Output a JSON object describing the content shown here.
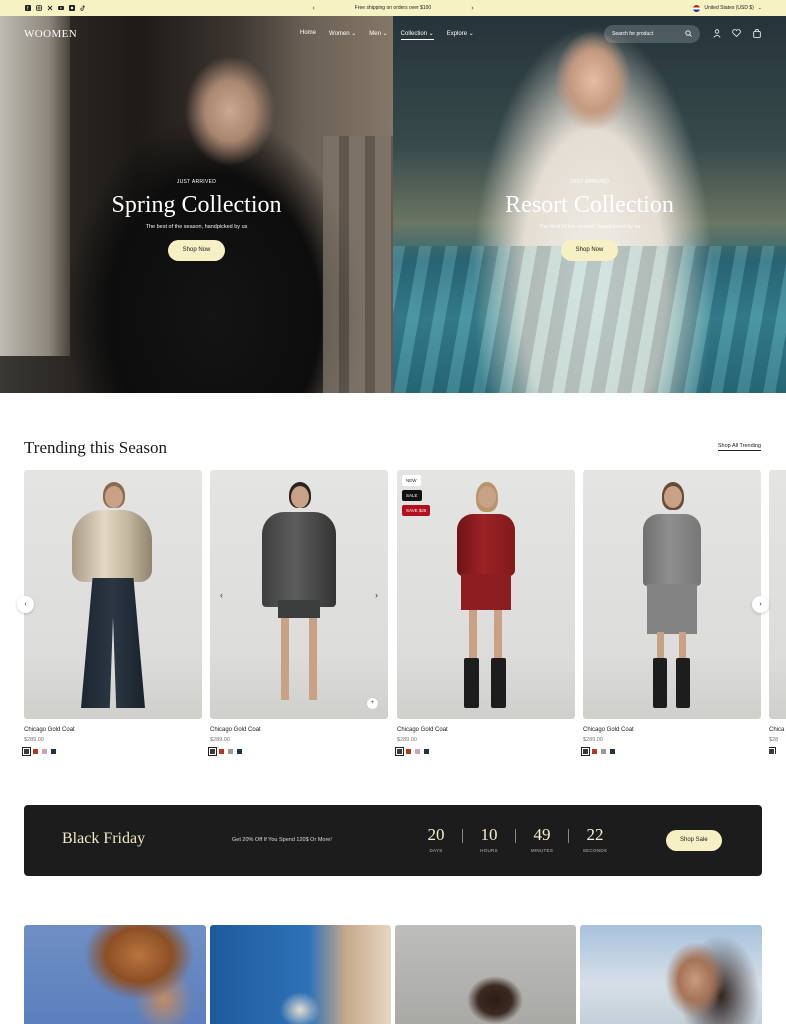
{
  "topbar": {
    "social_icons": [
      "facebook-icon",
      "instagram-icon",
      "x-icon",
      "youtube-icon",
      "pinterest-icon",
      "tiktok-icon"
    ],
    "announcement": "Free shipping on orders over $100",
    "prev_arrow": "‹",
    "next_arrow": "›",
    "country": "United States (USD $)",
    "country_chevron": "⌄"
  },
  "header": {
    "logo": "WOOMEN",
    "nav": [
      "Home",
      "Women ⌄",
      "Men ⌄",
      "Collection ⌄",
      "Explore ⌄"
    ],
    "active_nav": "Collection",
    "search_placeholder": "Search for product",
    "icons": [
      "search-icon",
      "account-icon",
      "wishlist-icon",
      "cart-icon"
    ]
  },
  "hero": {
    "left": {
      "kicker": "JUST ARRIVED",
      "title": "Spring Collection",
      "subtitle": "The best of the season, handpicked by us",
      "button": "Shop Now"
    },
    "right": {
      "kicker": "JUST ARRIVED",
      "title": "Resort Collection",
      "subtitle": "The best of the season, handpicked by us",
      "button": "Shop Now"
    }
  },
  "trending": {
    "title": "Trending this Season",
    "link": "Shop All Trending",
    "products": [
      {
        "name": "Chicago Gold Coat",
        "price": "$289.00",
        "swatches": [
          "#3a3a3a",
          "#b13a1a",
          "#c8a8b8",
          "#1c3550"
        ],
        "badges": []
      },
      {
        "name": "Chicago Gold Coat",
        "price": "$289.00",
        "swatches": [
          "#3a3a3a",
          "#b13a1a",
          "#9a9a9a",
          "#1c3550"
        ],
        "badges": []
      },
      {
        "name": "Chicago Gold Coat",
        "price": "$289.00",
        "swatches": [
          "#3a3a3a",
          "#b13a1a",
          "#c8a8b8",
          "#1c3550"
        ],
        "badges": [
          "NEW",
          "SALE",
          "SAVE $25"
        ]
      },
      {
        "name": "Chicago Gold Coat",
        "price": "$289.00",
        "swatches": [
          "#3a3a3a",
          "#b13a1a",
          "#9a9a9a",
          "#1c3550"
        ],
        "badges": []
      },
      {
        "name": "Chica",
        "price": "$28",
        "swatches": [
          "#3a3a3a"
        ],
        "badges": []
      }
    ]
  },
  "promo": {
    "title": "Black Friday",
    "description": "Get 20% Off If You Spend 120$ Or More!",
    "countdown": [
      {
        "value": "20",
        "label": "DAYS"
      },
      {
        "value": "10",
        "label": "HOURS"
      },
      {
        "value": "49",
        "label": "MINUTES"
      },
      {
        "value": "22",
        "label": "SECONDS"
      }
    ],
    "button": "Shop Sale"
  },
  "colors": {
    "accent": "#f6f0c4",
    "announcement_bg": "#f7f2c4",
    "promo_bg": "#1c1c1c",
    "sale_badge": "#b3101e"
  }
}
